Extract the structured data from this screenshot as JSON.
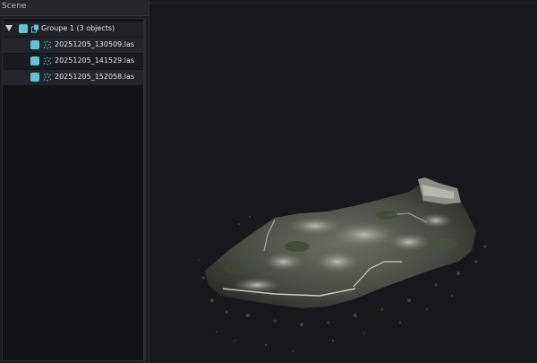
{
  "panel": {
    "title": "Scene",
    "group": {
      "label": "Groupe 1 (3 objects)",
      "expanded": true,
      "checked": true
    },
    "items": [
      {
        "label": "20251205_130509.las",
        "checked": true,
        "icon": "point-cloud-icon"
      },
      {
        "label": "20251205_141529.las",
        "checked": true,
        "icon": "point-cloud-icon"
      },
      {
        "label": "20251205_152058.las",
        "checked": true,
        "icon": "point-cloud-icon"
      }
    ]
  },
  "colors": {
    "panel_bg": "#1b1c20",
    "viewport_bg": "#17181b",
    "accent": "#5fc3d9"
  },
  "viewport": {
    "content": "point-cloud-render"
  }
}
